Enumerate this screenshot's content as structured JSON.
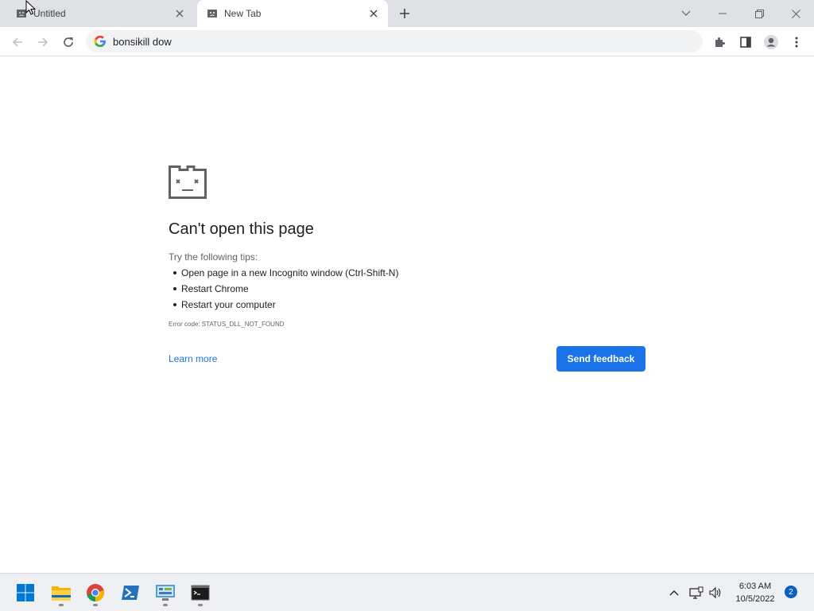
{
  "browser": {
    "tabs": [
      {
        "title": "Untitled",
        "active": false
      },
      {
        "title": "New Tab",
        "active": true
      }
    ],
    "address_bar": {
      "value": "bonsikill dow"
    }
  },
  "error_page": {
    "heading": "Can't open this page",
    "subheading": "Try the following tips:",
    "tips": [
      "Open page in a new Incognito window (Ctrl-Shift-N)",
      "Restart Chrome",
      "Restart your computer"
    ],
    "error_code": "Error code: STATUS_DLL_NOT_FOUND",
    "learn_more": "Learn more",
    "send_feedback": "Send feedback"
  },
  "taskbar": {
    "apps": [
      "start",
      "file-explorer",
      "chrome",
      "powershell",
      "control-panel",
      "terminal"
    ],
    "time": "6:03 AM",
    "date": "10/5/2022",
    "notification_count": "2"
  },
  "colors": {
    "accent": "#1a73e8",
    "tabstrip": "#dfe1e5",
    "omnibox": "#f1f3f4"
  }
}
